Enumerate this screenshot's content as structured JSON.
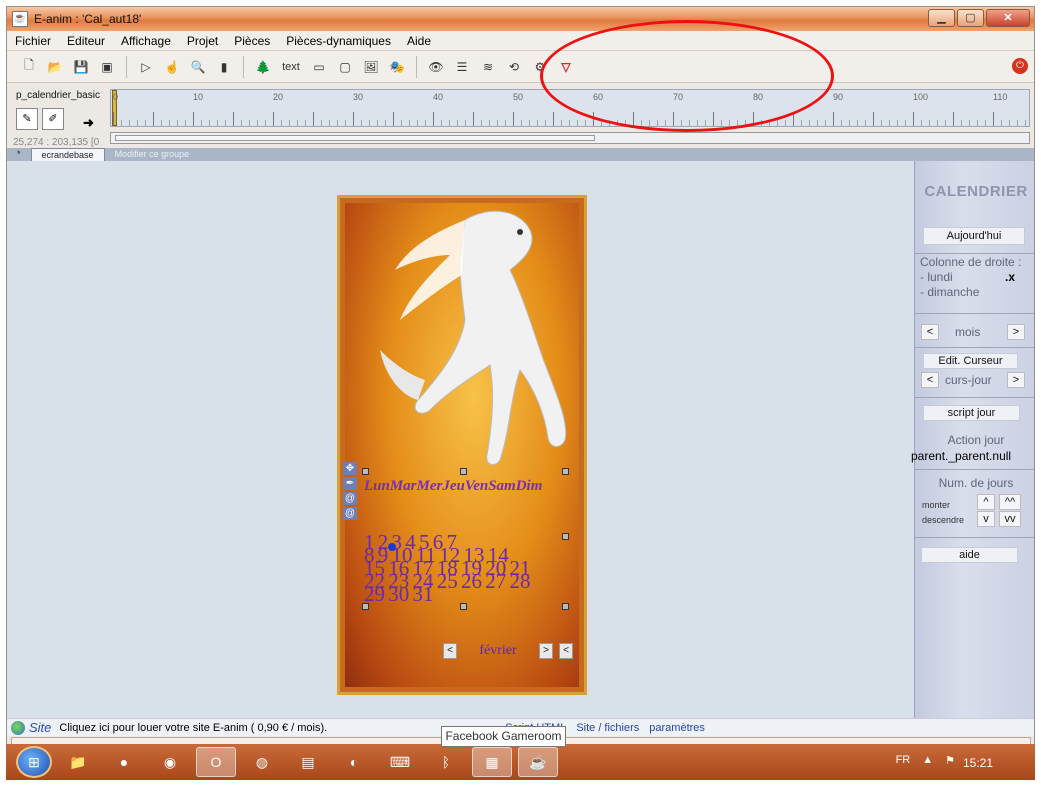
{
  "window": {
    "title": "E-anim : 'Cal_aut18'"
  },
  "menu": [
    "Fichier",
    "Editeur",
    "Affichage",
    "Projet",
    "Pièces",
    "Pièces-dynamiques",
    "Aide"
  ],
  "toolbar": {
    "text_label": "text"
  },
  "timeline": {
    "component": "p_calendrier_basic",
    "coords": "25,274 : 203,135 [0",
    "ruler_labels": [
      "0",
      "10",
      "20",
      "30",
      "40",
      "50",
      "60",
      "70",
      "80",
      "90",
      "100",
      "110"
    ],
    "tabs": [
      "*",
      "ecrandebase",
      "Modifier ce groupe"
    ]
  },
  "panel": {
    "title": "CALENDRIER",
    "today": "Aujourd'hui",
    "right_col": "Colonne de droite :",
    "monday": "- lundi",
    "monday_mark": ".x",
    "sunday": "- dimanche",
    "prev": "<",
    "next": ">",
    "mois": "mois",
    "edit_cursor": "Edit. Curseur",
    "curs_jour": "curs-jour",
    "script_jour": "script jour",
    "action_jour_label": "Action jour",
    "action_jour_value": "parent._parent.null",
    "num_jours": "Num. de jours",
    "monter": "monter",
    "descendre": "descendre",
    "up1": "^",
    "up2": "^^",
    "down1": "v",
    "down2": "vv",
    "aide": "aide"
  },
  "calendar": {
    "weekdays": "LunMarMerJeuVenSamDim",
    "rows": [
      "1 2 3 4 5 6 7",
      "8 9 10 11 12 13 14",
      "15 16 17 18 19 20 21",
      "22 23 24 25 26 27 28",
      "29 30 31"
    ],
    "month": "février",
    "nav_prev": "<",
    "nav_next": ">",
    "nav_prev2": "<"
  },
  "statusbar": {
    "site": "Site",
    "message": "Cliquez ici pour louer votre site E-anim ( 0,90 € / mois).",
    "link1": "Script HTML",
    "link2": "Site / fichiers",
    "link3": "paramètres"
  },
  "taskbar": {
    "tooltip": "Facebook Gameroom",
    "lang": "FR",
    "clock": "15:21"
  },
  "colors": {
    "accent": "#e07a3c",
    "panel": "#cbd1e4",
    "highlight": "#e11"
  }
}
